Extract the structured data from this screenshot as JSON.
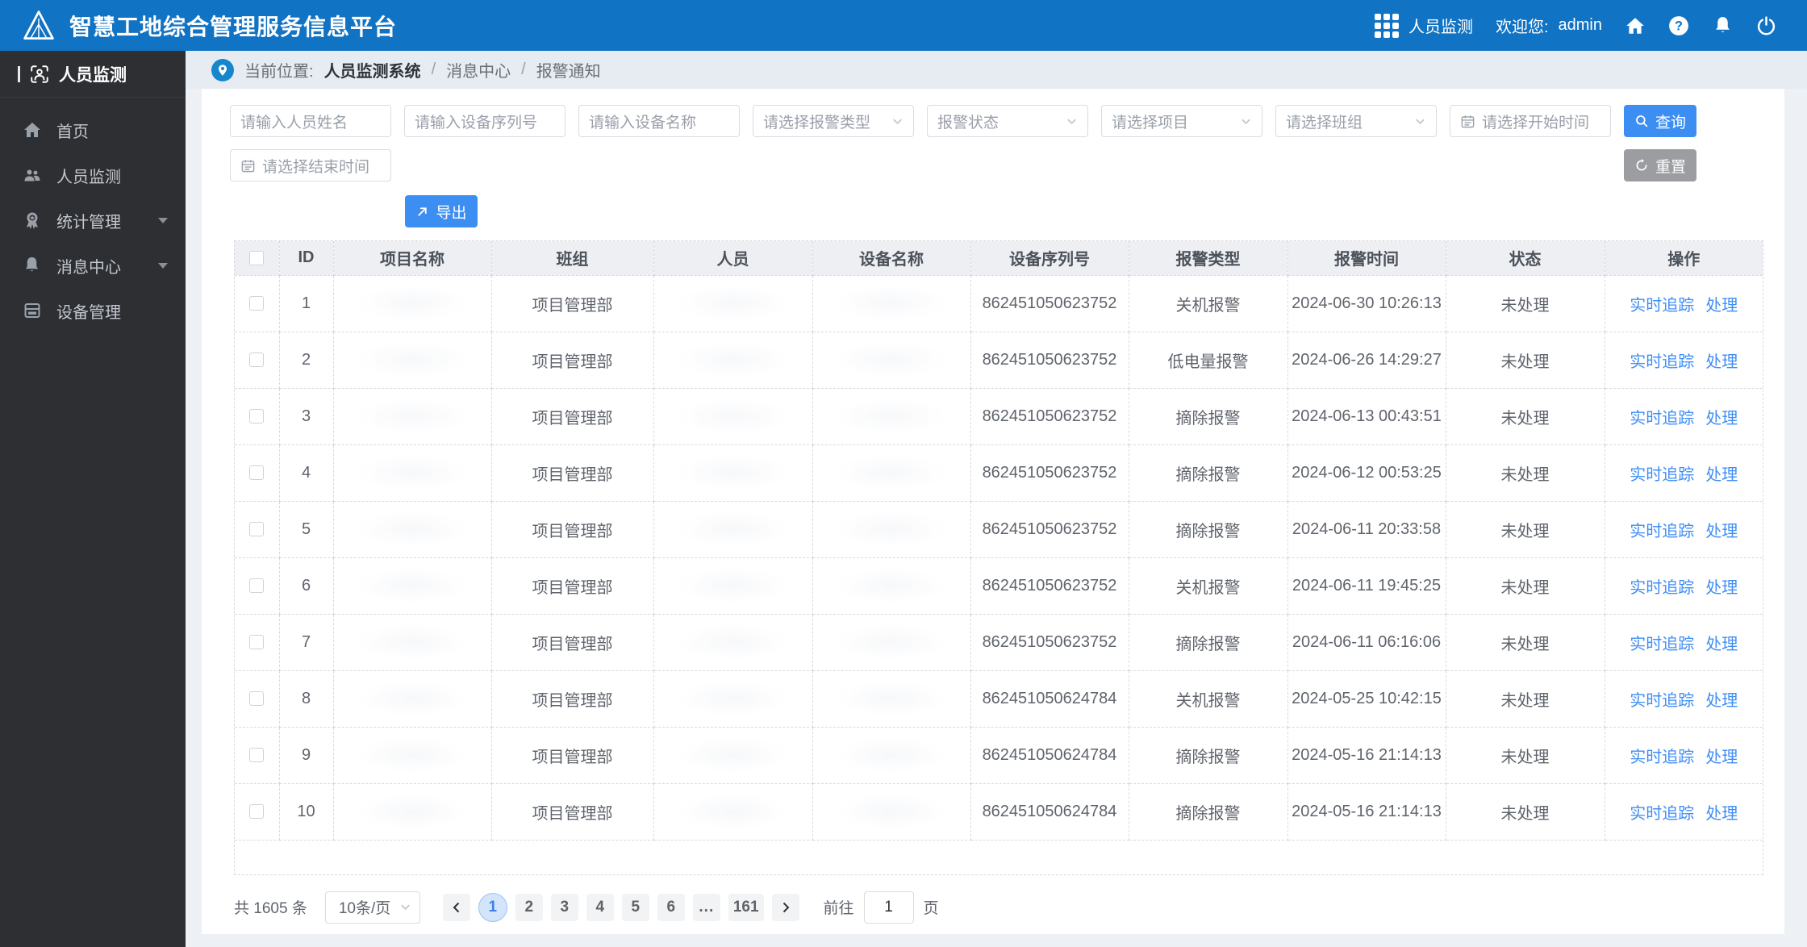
{
  "header": {
    "title": "智慧工地综合管理服务信息平台",
    "module": "人员监测",
    "welcome_label": "欢迎您:",
    "username": "admin"
  },
  "sidebar": {
    "title": "人员监测",
    "items": [
      {
        "label": "首页",
        "icon": "home-icon",
        "has_submenu": false
      },
      {
        "label": "人员监测",
        "icon": "users-icon",
        "has_submenu": false
      },
      {
        "label": "统计管理",
        "icon": "medal-icon",
        "has_submenu": true
      },
      {
        "label": "消息中心",
        "icon": "bell-icon",
        "has_submenu": true
      },
      {
        "label": "设备管理",
        "icon": "device-icon",
        "has_submenu": false
      }
    ]
  },
  "breadcrumb": {
    "label": "当前位置:",
    "system": "人员监测系统",
    "crumb1": "消息中心",
    "crumb2": "报警通知",
    "separator": "/"
  },
  "filters": {
    "name_placeholder": "请输入人员姓名",
    "serial_placeholder": "请输入设备序列号",
    "device_name_placeholder": "请输入设备名称",
    "alarm_type_placeholder": "请选择报警类型",
    "alarm_status_placeholder": "报警状态",
    "project_placeholder": "请选择项目",
    "team_placeholder": "请选择班组",
    "start_time_placeholder": "请选择开始时间",
    "end_time_placeholder": "请选择结束时间",
    "search_label": "查询",
    "reset_label": "重置",
    "export_label": "导出"
  },
  "table": {
    "columns": [
      "ID",
      "项目名称",
      "班组",
      "人员",
      "设备名称",
      "设备序列号",
      "报警类型",
      "报警时间",
      "状态",
      "操作"
    ],
    "action_labels": [
      "实时追踪",
      "处理"
    ],
    "rows": [
      {
        "id": "1",
        "team": "项目管理部",
        "serial": "862451050623752",
        "alarm_type": "关机报警",
        "alarm_time": "2024-06-30 10:26:13",
        "status": "未处理"
      },
      {
        "id": "2",
        "team": "项目管理部",
        "serial": "862451050623752",
        "alarm_type": "低电量报警",
        "alarm_time": "2024-06-26 14:29:27",
        "status": "未处理"
      },
      {
        "id": "3",
        "team": "项目管理部",
        "serial": "862451050623752",
        "alarm_type": "摘除报警",
        "alarm_time": "2024-06-13 00:43:51",
        "status": "未处理"
      },
      {
        "id": "4",
        "team": "项目管理部",
        "serial": "862451050623752",
        "alarm_type": "摘除报警",
        "alarm_time": "2024-06-12 00:53:25",
        "status": "未处理"
      },
      {
        "id": "5",
        "team": "项目管理部",
        "serial": "862451050623752",
        "alarm_type": "摘除报警",
        "alarm_time": "2024-06-11 20:33:58",
        "status": "未处理"
      },
      {
        "id": "6",
        "team": "项目管理部",
        "serial": "862451050623752",
        "alarm_type": "关机报警",
        "alarm_time": "2024-06-11 19:45:25",
        "status": "未处理"
      },
      {
        "id": "7",
        "team": "项目管理部",
        "serial": "862451050623752",
        "alarm_type": "摘除报警",
        "alarm_time": "2024-06-11 06:16:06",
        "status": "未处理"
      },
      {
        "id": "8",
        "team": "项目管理部",
        "serial": "862451050624784",
        "alarm_type": "关机报警",
        "alarm_time": "2024-05-25 10:42:15",
        "status": "未处理"
      },
      {
        "id": "9",
        "team": "项目管理部",
        "serial": "862451050624784",
        "alarm_type": "摘除报警",
        "alarm_time": "2024-05-16 21:14:13",
        "status": "未处理"
      },
      {
        "id": "10",
        "team": "项目管理部",
        "serial": "862451050624784",
        "alarm_type": "摘除报警",
        "alarm_time": "2024-05-16 21:14:13",
        "status": "未处理"
      }
    ]
  },
  "pagination": {
    "total_label": "共 1605 条",
    "page_size": "10条/页",
    "pages": [
      "1",
      "2",
      "3",
      "4",
      "5",
      "6",
      "...",
      "161"
    ],
    "active_page": "1",
    "goto_label": "前往",
    "goto_value": "1",
    "goto_suffix": "页"
  },
  "colors": {
    "header_blue": "#1173c3",
    "primary_button": "#3d8ef2",
    "link_blue": "#3f8ef5",
    "sidebar_bg": "#2d2f33",
    "breadcrumb_bg": "#e7ecf3",
    "active_page_bg": "#d4e4fb"
  }
}
